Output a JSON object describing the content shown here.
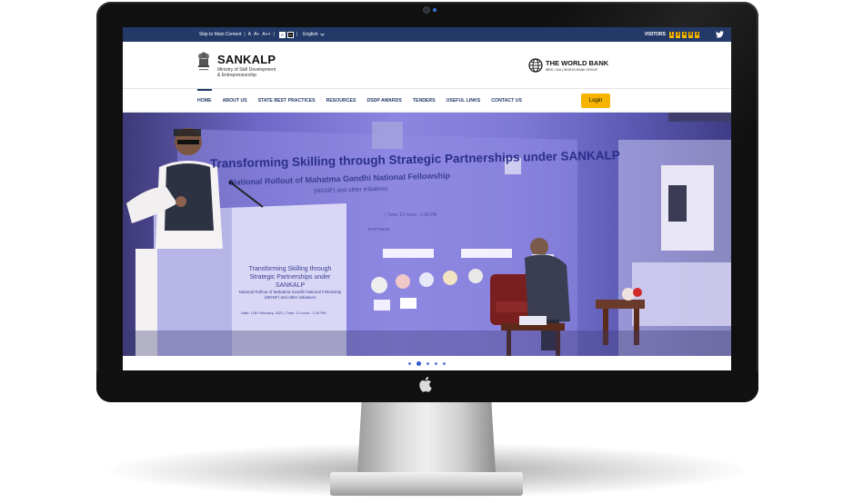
{
  "topbar": {
    "skip_link": "Skip to Main Content",
    "font_small": "A",
    "font_medium": "A+",
    "font_large": "A++",
    "contrast_light": "A",
    "contrast_dark": "A",
    "language": "English",
    "visitors_label": "VISITORS",
    "visitor_digits": [
      "1",
      "3",
      "4",
      "8",
      "4"
    ]
  },
  "header": {
    "brand_title": "SANKALP",
    "brand_subtitle_line1": "Ministry of Skill Development",
    "brand_subtitle_line2": "& Entrepreneurship",
    "partner_title": "THE WORLD BANK",
    "partner_subtitle": "IBRD • IDA | WORLD BANK GROUP"
  },
  "nav": {
    "items": [
      {
        "label": "HOME",
        "active": true
      },
      {
        "label": "ABOUT US"
      },
      {
        "label": "STATE BEST PRACTICES"
      },
      {
        "label": "RESOURCES"
      },
      {
        "label": "DSDP AWARDS"
      },
      {
        "label": "TENDERS"
      },
      {
        "label": "USEFUL LINKS"
      },
      {
        "label": "CONTACT US"
      }
    ],
    "login_label": "Login"
  },
  "hero": {
    "banner_title": "Transforming Skilling through Strategic Partnerships under SANKALP",
    "banner_subtitle": "National Rollout of Mahatma Gandhi National Fellowship",
    "banner_subtitle2": "(MGNF) and other initiatives",
    "time_text": "| Time: 12 noon - 1:30 PM",
    "partners_text": "PARTNERS",
    "podium_title": "Transforming Skilling through Strategic Partnerships under SANKALP",
    "podium_subtitle": "National Rollout of Mahatma Gandhi National Fellowship (MGNF) and other initiatives",
    "podium_date": "Date: 12th February, 2021 | Time: 12 noon - 1:30 PM",
    "slides_total": 5,
    "slide_active": 2
  },
  "colors": {
    "topbar_bg": "#233a69",
    "accent_yellow": "#f5b400",
    "nav_text": "#233a69"
  }
}
